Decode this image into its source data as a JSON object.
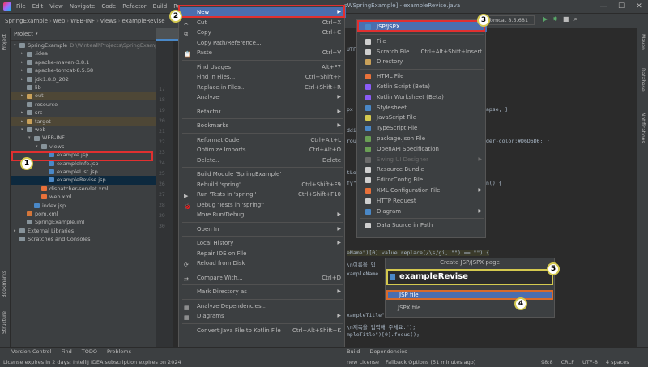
{
  "menubar": {
    "items": [
      "File",
      "Edit",
      "View",
      "Navigate",
      "Code",
      "Refactor",
      "Build",
      "Run"
    ]
  },
  "window": {
    "caption": "sWSpringExample] - exampleRevise.java",
    "controls": [
      "—",
      "☐",
      "✕"
    ]
  },
  "navbar": {
    "crumbs": [
      "SpringExample",
      "web",
      "WEB-INF",
      "views",
      "exampleRevise"
    ]
  },
  "run_config": {
    "label": "Tomcat 8.5.681"
  },
  "left_strip": {
    "top_label": "Project",
    "bottom_labels": [
      "Bookmarks",
      "Structure"
    ]
  },
  "right_strip": {
    "labels": [
      "Maven",
      "Database",
      "Notifications"
    ]
  },
  "project_panel": {
    "title": "Project",
    "tree": [
      {
        "label": "SpringExample",
        "path": "D:\\Winteall\\Projects\\SpringExamp",
        "depth": 0,
        "kind": "folder",
        "arrow": "▾"
      },
      {
        "label": ".idea",
        "depth": 1,
        "kind": "folder",
        "arrow": "▸"
      },
      {
        "label": "apache-maven-3.8.1",
        "depth": 1,
        "kind": "folder",
        "arrow": "▸"
      },
      {
        "label": "apache-tomcat-8.5.68",
        "depth": 1,
        "kind": "folder",
        "arrow": "▸"
      },
      {
        "label": "jdk1.8.0_202",
        "depth": 1,
        "kind": "folder",
        "arrow": "▸"
      },
      {
        "label": "lib",
        "depth": 1,
        "kind": "folder",
        "arrow": ""
      },
      {
        "label": "out",
        "depth": 1,
        "kind": "excluded",
        "arrow": "▸"
      },
      {
        "label": "resource",
        "depth": 1,
        "kind": "folder",
        "arrow": ""
      },
      {
        "label": "src",
        "depth": 1,
        "kind": "folder",
        "arrow": "▸"
      },
      {
        "label": "target",
        "depth": 1,
        "kind": "excluded",
        "arrow": "▸"
      },
      {
        "label": "web",
        "depth": 1,
        "kind": "folder",
        "arrow": "▾"
      },
      {
        "label": "WEB-INF",
        "depth": 2,
        "kind": "folder",
        "arrow": "▾"
      },
      {
        "label": "views",
        "depth": 3,
        "kind": "folder",
        "arrow": "▾"
      },
      {
        "label": "example.jsp",
        "depth": 4,
        "kind": "jsp",
        "arrow": ""
      },
      {
        "label": "exampleInfo.jsp",
        "depth": 4,
        "kind": "jsp",
        "arrow": ""
      },
      {
        "label": "exampleList.jsp",
        "depth": 4,
        "kind": "jsp",
        "arrow": ""
      },
      {
        "label": "exampleRevise.jsp",
        "depth": 4,
        "kind": "jsp",
        "arrow": "",
        "selected": true
      },
      {
        "label": "dispatcher-servlet.xml",
        "depth": 3,
        "kind": "xml",
        "arrow": ""
      },
      {
        "label": "web.xml",
        "depth": 3,
        "kind": "xml",
        "arrow": ""
      },
      {
        "label": "index.jsp",
        "depth": 2,
        "kind": "jsp",
        "arrow": ""
      },
      {
        "label": "pom.xml",
        "depth": 1,
        "kind": "maven",
        "arrow": ""
      },
      {
        "label": "SpringExample.iml",
        "depth": 1,
        "kind": "iml",
        "arrow": ""
      },
      {
        "label": "External Libraries",
        "depth": 0,
        "kind": "lib",
        "arrow": "▸"
      },
      {
        "label": "Scratches and Consoles",
        "depth": 0,
        "kind": "scratch",
        "arrow": ""
      }
    ]
  },
  "editor": {
    "line_numbers": [
      "17",
      "18",
      "19",
      "20",
      "21",
      "22",
      "23",
      "24",
      "25",
      "26",
      "27",
      "28",
      "29",
      "30"
    ],
    "code_fragments": [
      {
        "text": "UTF-",
        "row": 0
      },
      {
        "text": "px",
        "row": 1
      },
      {
        "text": "apse; }",
        "row": 2
      },
      {
        "text": "ddin",
        "row": 3
      },
      {
        "text": "roun",
        "row": 4
      },
      {
        "text": "der-color:#D6D6D6; }",
        "row": 5
      },
      {
        "text": "tLoa",
        "row": 6
      },
      {
        "text": "fy\")",
        "row": 7
      },
      {
        "text": "n() {",
        "row": 8
      },
      {
        "text": "eName\")[0].value.replace(/\\s/gi, \"\") == \"\") {",
        "row": 9
      },
      {
        "text": "\\n이름을 입",
        "row": 10
      },
      {
        "text": "xampleName",
        "row": 11
      },
      {
        "text": "xampleTitle\")[0].value.replace(/\\s/gi, \"\") == \"\") {",
        "row": 12
      },
      {
        "text": "\\n제목을 입력해 주세요.\");",
        "row": 13
      },
      {
        "text": "mpleTitle\")[0].focus();",
        "row": 14
      }
    ]
  },
  "context_menu": {
    "items": [
      {
        "label": "New",
        "shortcut": "",
        "sub": true,
        "selected": true,
        "sep": false
      },
      {
        "label": "Cut",
        "shortcut": "Ctrl+X",
        "sub": false,
        "sep": false,
        "icon": "✂"
      },
      {
        "label": "Copy",
        "shortcut": "Ctrl+C",
        "sub": false,
        "sep": false,
        "icon": "⧉"
      },
      {
        "label": "Copy Path/Reference...",
        "shortcut": "",
        "sub": false,
        "sep": false
      },
      {
        "label": "Paste",
        "shortcut": "Ctrl+V",
        "sub": false,
        "sep": true,
        "icon": "📋"
      },
      {
        "label": "Find Usages",
        "shortcut": "Alt+F7",
        "sub": false,
        "sep": false
      },
      {
        "label": "Find in Files...",
        "shortcut": "Ctrl+Shift+F",
        "sub": false,
        "sep": false
      },
      {
        "label": "Replace in Files...",
        "shortcut": "Ctrl+Shift+R",
        "sub": false,
        "sep": false
      },
      {
        "label": "Analyze",
        "shortcut": "",
        "sub": true,
        "sep": true
      },
      {
        "label": "Refactor",
        "shortcut": "",
        "sub": true,
        "sep": true
      },
      {
        "label": "Bookmarks",
        "shortcut": "",
        "sub": true,
        "sep": true
      },
      {
        "label": "Reformat Code",
        "shortcut": "Ctrl+Alt+L",
        "sub": false,
        "sep": false
      },
      {
        "label": "Optimize Imports",
        "shortcut": "Ctrl+Alt+O",
        "sub": false,
        "sep": false
      },
      {
        "label": "Delete...",
        "shortcut": "Delete",
        "sub": false,
        "sep": true
      },
      {
        "label": "Build Module 'SpringExample'",
        "shortcut": "",
        "sub": false,
        "sep": false
      },
      {
        "label": "Rebuild 'spring'",
        "shortcut": "Ctrl+Shift+F9",
        "sub": false,
        "sep": false
      },
      {
        "label": "Run 'Tests in 'spring''",
        "shortcut": "Ctrl+Shift+F10",
        "sub": false,
        "sep": false,
        "icon": "▶"
      },
      {
        "label": "Debug 'Tests in 'spring''",
        "shortcut": "",
        "sub": false,
        "sep": false,
        "icon": "🐞"
      },
      {
        "label": "More Run/Debug",
        "shortcut": "",
        "sub": true,
        "sep": true
      },
      {
        "label": "Open In",
        "shortcut": "",
        "sub": true,
        "sep": true
      },
      {
        "label": "Local History",
        "shortcut": "",
        "sub": true,
        "sep": false
      },
      {
        "label": "Repair IDE on File",
        "shortcut": "",
        "sub": false,
        "sep": false
      },
      {
        "label": "Reload from Disk",
        "shortcut": "",
        "sub": false,
        "sep": true,
        "icon": "⟳"
      },
      {
        "label": "Compare With...",
        "shortcut": "Ctrl+D",
        "sub": false,
        "sep": true,
        "icon": "⇄"
      },
      {
        "label": "Mark Directory as",
        "shortcut": "",
        "sub": true,
        "sep": true
      },
      {
        "label": "Analyze Dependencies...",
        "shortcut": "",
        "sub": false,
        "sep": false,
        "icon": "▦"
      },
      {
        "label": "Diagrams",
        "shortcut": "",
        "sub": true,
        "sep": true,
        "icon": "▦"
      },
      {
        "label": "Convert Java File to Kotlin File",
        "shortcut": "Ctrl+Alt+Shift+K",
        "sub": false,
        "sep": false
      }
    ]
  },
  "submenu_new": {
    "items": [
      {
        "label": "JSP/JSPX",
        "shortcut": "",
        "sub": false,
        "selected": true,
        "sep": true,
        "color": "#4a88c7"
      },
      {
        "label": "File",
        "shortcut": "",
        "sub": false,
        "sep": false,
        "color": "#cfcfcf"
      },
      {
        "label": "Scratch File",
        "shortcut": "Ctrl+Alt+Shift+Insert",
        "sub": false,
        "sep": false,
        "color": "#cfcfcf"
      },
      {
        "label": "Directory",
        "shortcut": "",
        "sub": false,
        "sep": true,
        "color": "#c9a15a"
      },
      {
        "label": "HTML File",
        "shortcut": "",
        "sub": false,
        "sep": false,
        "color": "#e8713a"
      },
      {
        "label": "Kotlin Script (Beta)",
        "shortcut": "",
        "sub": false,
        "sep": false,
        "color": "#8a5cf6"
      },
      {
        "label": "Kotlin Worksheet (Beta)",
        "shortcut": "",
        "sub": false,
        "sep": false,
        "color": "#8a5cf6"
      },
      {
        "label": "Stylesheet",
        "shortcut": "",
        "sub": false,
        "sep": false,
        "color": "#4a88c7"
      },
      {
        "label": "JavaScript File",
        "shortcut": "",
        "sub": false,
        "sep": false,
        "color": "#d4c94f"
      },
      {
        "label": "TypeScript File",
        "shortcut": "",
        "sub": false,
        "sep": false,
        "color": "#4a88c7"
      },
      {
        "label": "package.json File",
        "shortcut": "",
        "sub": false,
        "sep": false,
        "color": "#6a9f55"
      },
      {
        "label": "OpenAPI Specification",
        "shortcut": "",
        "sub": false,
        "sep": false,
        "color": "#6a9f55"
      },
      {
        "label": "Swing UI Designer",
        "shortcut": "",
        "sub": true,
        "sep": false,
        "disabled": true,
        "color": "#6b6b6b"
      },
      {
        "label": "Resource Bundle",
        "shortcut": "",
        "sub": false,
        "sep": false,
        "color": "#cfcfcf"
      },
      {
        "label": "EditorConfig File",
        "shortcut": "",
        "sub": false,
        "sep": false,
        "color": "#cfcfcf"
      },
      {
        "label": "XML Configuration File",
        "shortcut": "",
        "sub": true,
        "sep": false,
        "color": "#e8713a"
      },
      {
        "label": "HTTP Request",
        "shortcut": "",
        "sub": false,
        "sep": false,
        "color": "#cfcfcf"
      },
      {
        "label": "Diagram",
        "shortcut": "",
        "sub": true,
        "sep": true,
        "color": "#4a88c7"
      },
      {
        "label": "Data Source in Path",
        "shortcut": "",
        "sub": false,
        "sep": false,
        "color": "#cfcfcf"
      }
    ]
  },
  "dialog": {
    "title": "Create JSP/JSPX page",
    "input_value": "exampleRevise",
    "options": [
      {
        "label": "JSP file",
        "selected": true
      },
      {
        "label": "JSPX file",
        "selected": false
      }
    ]
  },
  "callouts": [
    "1",
    "2",
    "3",
    "4",
    "5"
  ],
  "status": {
    "tool_windows": [
      "Version Control",
      "Find",
      "TODO",
      "Problems"
    ],
    "mid_tools": [
      "Build",
      "Dependencies"
    ],
    "license": "License expires in 2 days: IntelliJ IDEA subscription expires on 2024",
    "mid_status": [
      "new License",
      "Fallback Options (51 minutes ago)"
    ],
    "right": [
      "98:8",
      "CRLF",
      "UTF-8",
      "4 spaces"
    ]
  },
  "colors": {
    "accent": "#4b6eaf",
    "callout_border": "#d4c94f",
    "highlight_red": "#e03030",
    "dialog_selection_border": "#d86a2c"
  }
}
